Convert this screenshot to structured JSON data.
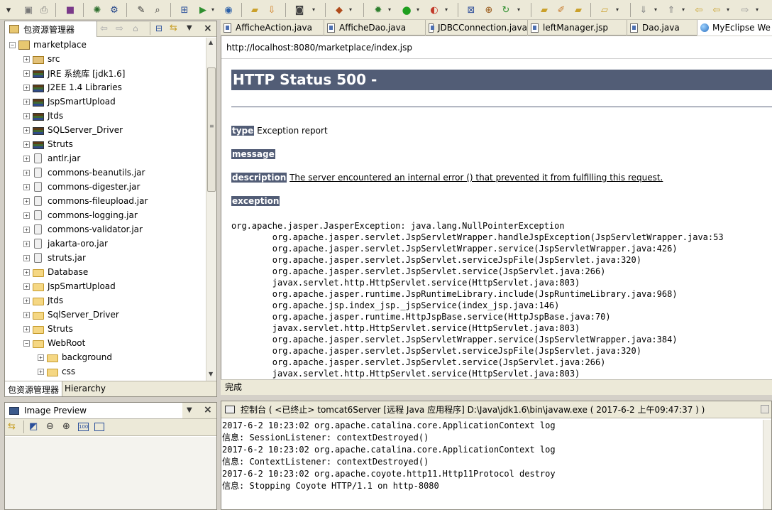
{
  "toolbar": {
    "icons": [
      "new-icon",
      "save-icon",
      "print-icon",
      "new-package-icon",
      "debug-config-icon",
      "web-service-icon",
      "search-icon",
      "search-file-icon",
      "deploy-icon",
      "server-icon",
      "browser-icon",
      "screenshot-icon",
      "new-wizard-icon",
      "bug-icon",
      "run-icon",
      "external-tools-icon",
      "open-type-icon",
      "open-resource-icon",
      "refresh-icon",
      "folder-open-icon",
      "pencil-icon",
      "annotation-icon",
      "folder-icon",
      "next-annotation-icon",
      "prev-annotation-icon",
      "back-icon",
      "back-arrow-icon",
      "forward-arrow-icon"
    ]
  },
  "package_explorer": {
    "tab_label": "包资源管理器",
    "bottom_tabs": [
      "包资源管理器",
      "Hierarchy"
    ],
    "tree": [
      {
        "label": "marketplace",
        "type": "project",
        "expanded": true
      },
      {
        "label": "src",
        "type": "package"
      },
      {
        "label": "JRE 系统库 [jdk1.6]",
        "type": "lib"
      },
      {
        "label": "J2EE 1.4 Libraries",
        "type": "lib"
      },
      {
        "label": "JspSmartUpload",
        "type": "lib"
      },
      {
        "label": "Jtds",
        "type": "lib"
      },
      {
        "label": "SQLServer_Driver",
        "type": "lib"
      },
      {
        "label": "Struts",
        "type": "lib"
      },
      {
        "label": "antlr.jar",
        "type": "jar"
      },
      {
        "label": "commons-beanutils.jar",
        "type": "jar"
      },
      {
        "label": "commons-digester.jar",
        "type": "jar"
      },
      {
        "label": "commons-fileupload.jar",
        "type": "jar"
      },
      {
        "label": "commons-logging.jar",
        "type": "jar"
      },
      {
        "label": "commons-validator.jar",
        "type": "jar"
      },
      {
        "label": "jakarta-oro.jar",
        "type": "jar"
      },
      {
        "label": "struts.jar",
        "type": "jar"
      },
      {
        "label": "Database",
        "type": "folder"
      },
      {
        "label": "JspSmartUpload",
        "type": "folder"
      },
      {
        "label": "Jtds",
        "type": "folder"
      },
      {
        "label": "SqlServer_Driver",
        "type": "folder"
      },
      {
        "label": "Struts",
        "type": "folder"
      },
      {
        "label": "WebRoot",
        "type": "folder",
        "expanded": true
      },
      {
        "label": "background",
        "type": "folder"
      },
      {
        "label": "css",
        "type": "folder"
      }
    ]
  },
  "image_preview": {
    "title": "Image Preview"
  },
  "editor": {
    "tabs": [
      {
        "label": "AfficheAction.java"
      },
      {
        "label": "AfficheDao.java"
      },
      {
        "label": "JDBCConnection.java"
      },
      {
        "label": "leftManager.jsp"
      },
      {
        "label": "Dao.java"
      },
      {
        "label": "MyEclipse We"
      }
    ]
  },
  "browser": {
    "url": "http://localhost:8080/marketplace/index.jsp",
    "heading": "HTTP Status 500 -",
    "type_label": "type",
    "type_value": "Exception report",
    "message_label": "message",
    "description_label": "description",
    "description_value": "The server encountered an internal error () that prevented it from fulfilling this request.",
    "exception_label": "exception",
    "trace": [
      "org.apache.jasper.JasperException: java.lang.NullPointerException",
      "\torg.apache.jasper.servlet.JspServletWrapper.handleJspException(JspServletWrapper.java:53",
      "\torg.apache.jasper.servlet.JspServletWrapper.service(JspServletWrapper.java:426)",
      "\torg.apache.jasper.servlet.JspServlet.serviceJspFile(JspServlet.java:320)",
      "\torg.apache.jasper.servlet.JspServlet.service(JspServlet.java:266)",
      "\tjavax.servlet.http.HttpServlet.service(HttpServlet.java:803)",
      "\torg.apache.jasper.runtime.JspRuntimeLibrary.include(JspRuntimeLibrary.java:968)",
      "\torg.apache.jsp.index_jsp._jspService(index_jsp.java:146)",
      "\torg.apache.jasper.runtime.HttpJspBase.service(HttpJspBase.java:70)",
      "\tjavax.servlet.http.HttpServlet.service(HttpServlet.java:803)",
      "\torg.apache.jasper.servlet.JspServletWrapper.service(JspServletWrapper.java:384)",
      "\torg.apache.jasper.servlet.JspServlet.serviceJspFile(JspServlet.java:320)",
      "\torg.apache.jasper.servlet.JspServlet.service(JspServlet.java:266)",
      "\tjavax.servlet.http.HttpServlet.service(HttpServlet.java:803)"
    ],
    "status": "完成"
  },
  "console": {
    "title": "控制台 ( <已终止> tomcat6Server [远程 Java 应用程序] D:\\Java\\jdk1.6\\bin\\javaw.exe ( 2017-6-2 上午09:47:37 ) )",
    "lines": [
      "2017-6-2 10:23:02 org.apache.catalina.core.ApplicationContext log",
      "信息: SessionListener: contextDestroyed()",
      "2017-6-2 10:23:02 org.apache.catalina.core.ApplicationContext log",
      "信息: ContextListener: contextDestroyed()",
      "2017-6-2 10:23:02 org.apache.coyote.http11.Http11Protocol destroy",
      "信息: Stopping Coyote HTTP/1.1 on http-8080"
    ]
  },
  "colors": {
    "tomcat_heading": "#525d76",
    "chrome": "#ece9d8"
  }
}
